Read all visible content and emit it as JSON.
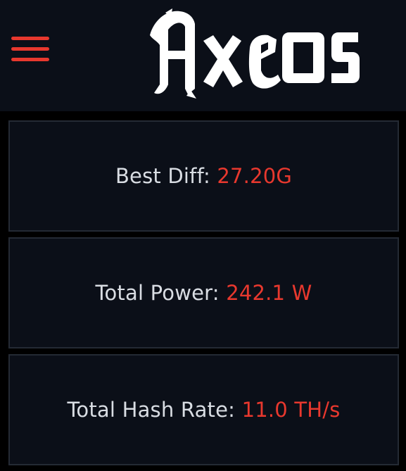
{
  "header": {
    "logo_text": "AxeOS",
    "menu_icon": "hamburger-menu-icon"
  },
  "stats": [
    {
      "label": "Best Diff:",
      "value": "27.20G"
    },
    {
      "label": "Total Power:",
      "value": "242.1 W"
    },
    {
      "label": "Total Hash Rate:",
      "value": "11.0 TH/s"
    }
  ],
  "colors": {
    "background": "#000000",
    "panel": "#0b0f18",
    "border": "#242a34",
    "accent": "#e8382e",
    "label_text": "#d9dde3",
    "logo": "#ffffff"
  }
}
